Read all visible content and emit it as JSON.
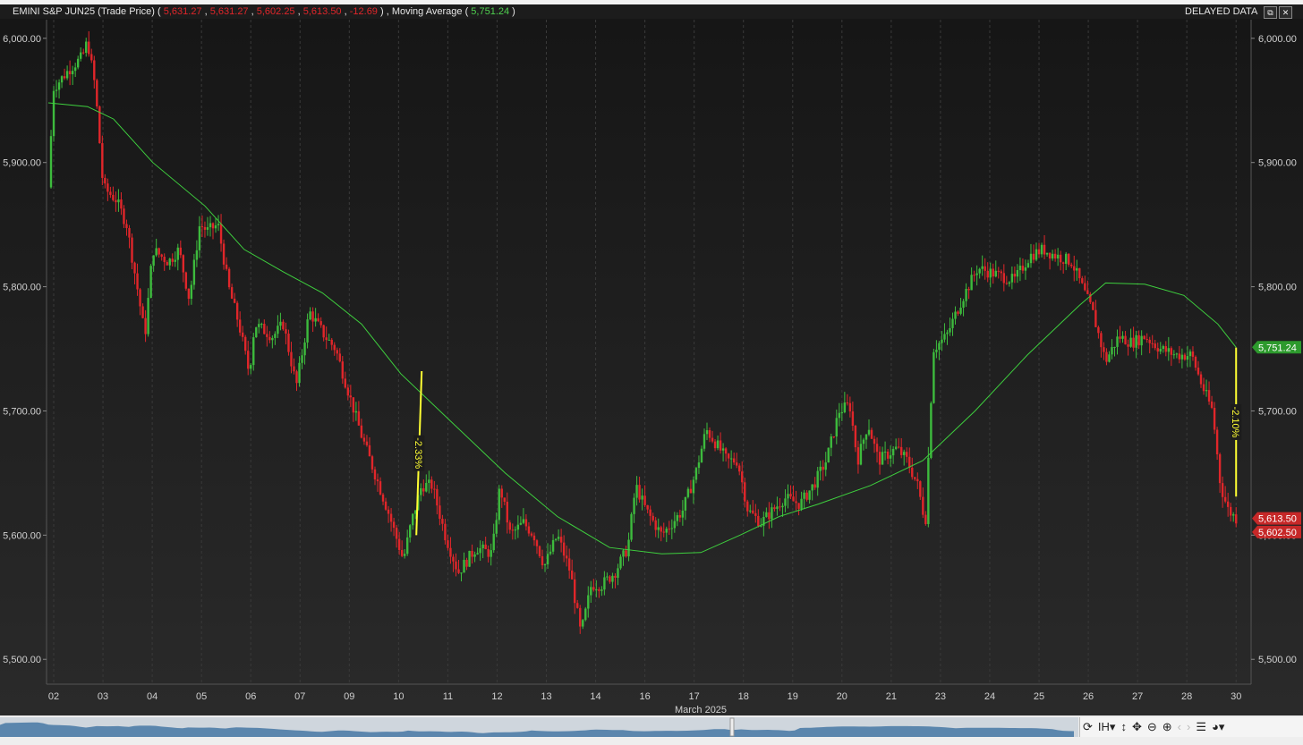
{
  "header": {
    "instrument": "EMINI S&P JUN25 (Trade Price)",
    "open": "5,631.27",
    "high": "5,631.27",
    "low": "5,602.25",
    "close": "5,613.50",
    "change": "-12.69",
    "ma_label": "Moving Average",
    "ma_value": "5,751.24",
    "delayed": "DELAYED DATA"
  },
  "colors": {
    "background": "#1c1c1c",
    "up": "#3dbb3d",
    "down": "#e0262a",
    "ma_line": "#3ecf3e",
    "annotation": "#ffff33",
    "grid": "#3a3a3a"
  },
  "toolbar": {
    "icons": [
      "refresh-icon",
      "bar-type-icon",
      "vertical-resize-icon",
      "pan-icon",
      "zoom-out-icon",
      "zoom-in-icon",
      "chevron-left-icon",
      "chevron-right-icon",
      "menu-icon",
      "palette-icon"
    ]
  },
  "chart_data": {
    "type": "candlestick",
    "title": "EMINI S&P JUN25 (Trade Price)",
    "x_title": "March 2025",
    "x_ticks": [
      "02",
      "03",
      "04",
      "05",
      "06",
      "07",
      "09",
      "10",
      "11",
      "12",
      "13",
      "14",
      "16",
      "17",
      "18",
      "19",
      "20",
      "21",
      "23",
      "24",
      "25",
      "26",
      "27",
      "28",
      "30"
    ],
    "y_ticks": [
      "6,000.00",
      "5,900.00",
      "5,800.00",
      "5,700.00",
      "5,600.00",
      "5,500.00"
    ],
    "ylim": [
      5480,
      6015
    ],
    "price_path": [
      [
        0,
        5880
      ],
      [
        0.2,
        5960
      ],
      [
        0.8,
        5975
      ],
      [
        1.3,
        5985
      ],
      [
        1.5,
        5998
      ],
      [
        1.8,
        5960
      ],
      [
        2.1,
        5880
      ],
      [
        2.6,
        5870
      ],
      [
        3.0,
        5850
      ],
      [
        3.4,
        5800
      ],
      [
        3.7,
        5760
      ],
      [
        4.0,
        5830
      ],
      [
        4.6,
        5820
      ],
      [
        5.0,
        5830
      ],
      [
        5.4,
        5790
      ],
      [
        5.8,
        5850
      ],
      [
        6.1,
        5845
      ],
      [
        6.5,
        5850
      ],
      [
        6.9,
        5800
      ],
      [
        7.3,
        5770
      ],
      [
        7.7,
        5730
      ],
      [
        7.9,
        5770
      ],
      [
        8.6,
        5760
      ],
      [
        9.0,
        5770
      ],
      [
        9.5,
        5720
      ],
      [
        10.0,
        5780
      ],
      [
        10.6,
        5760
      ],
      [
        11.0,
        5750
      ],
      [
        12.0,
        5680
      ],
      [
        13.0,
        5620
      ],
      [
        13.6,
        5580
      ],
      [
        13.9,
        5610
      ],
      [
        14.3,
        5640
      ],
      [
        14.7,
        5640
      ],
      [
        15.2,
        5600
      ],
      [
        15.7,
        5570
      ],
      [
        16.4,
        5590
      ],
      [
        17.0,
        5585
      ],
      [
        17.3,
        5640
      ],
      [
        17.7,
        5600
      ],
      [
        18.2,
        5610
      ],
      [
        18.6,
        5600
      ],
      [
        19.0,
        5575
      ],
      [
        19.5,
        5600
      ],
      [
        20.0,
        5570
      ],
      [
        20.4,
        5520
      ],
      [
        20.8,
        5560
      ],
      [
        21.2,
        5560
      ],
      [
        21.7,
        5570
      ],
      [
        22.2,
        5590
      ],
      [
        22.5,
        5640
      ],
      [
        22.9,
        5620
      ],
      [
        23.5,
        5600
      ],
      [
        24.3,
        5620
      ],
      [
        24.8,
        5650
      ],
      [
        25.2,
        5685
      ],
      [
        25.7,
        5670
      ],
      [
        26.0,
        5660
      ],
      [
        26.4,
        5660
      ],
      [
        26.8,
        5620
      ],
      [
        27.3,
        5610
      ],
      [
        28.2,
        5630
      ],
      [
        28.8,
        5625
      ],
      [
        29.3,
        5640
      ],
      [
        29.8,
        5660
      ],
      [
        30.3,
        5700
      ],
      [
        30.7,
        5705
      ],
      [
        31.0,
        5660
      ],
      [
        31.4,
        5690
      ],
      [
        31.8,
        5660
      ],
      [
        32.5,
        5670
      ],
      [
        32.9,
        5660
      ],
      [
        33.3,
        5640
      ],
      [
        33.6,
        5610
      ],
      [
        33.9,
        5750
      ],
      [
        34.4,
        5760
      ],
      [
        35.0,
        5790
      ],
      [
        35.6,
        5815
      ],
      [
        36.3,
        5810
      ],
      [
        37.0,
        5805
      ],
      [
        37.6,
        5825
      ],
      [
        38.1,
        5830
      ],
      [
        38.6,
        5825
      ],
      [
        39.2,
        5820
      ],
      [
        39.6,
        5800
      ],
      [
        40.0,
        5780
      ],
      [
        40.5,
        5740
      ],
      [
        41.0,
        5760
      ],
      [
        41.5,
        5755
      ],
      [
        42.0,
        5760
      ],
      [
        42.6,
        5750
      ],
      [
        43.2,
        5745
      ],
      [
        43.8,
        5745
      ],
      [
        44.2,
        5720
      ],
      [
        44.6,
        5700
      ],
      [
        44.9,
        5640
      ],
      [
        45.2,
        5620
      ],
      [
        45.5,
        5613.5
      ]
    ],
    "series": [
      {
        "name": "Moving Average",
        "type": "line",
        "points": [
          [
            0,
            5948
          ],
          [
            1.5,
            5945
          ],
          [
            2.5,
            5935
          ],
          [
            4.0,
            5900
          ],
          [
            6.0,
            5865
          ],
          [
            7.5,
            5830
          ],
          [
            9.0,
            5812
          ],
          [
            10.5,
            5795
          ],
          [
            12.0,
            5770
          ],
          [
            13.5,
            5730
          ],
          [
            15.5,
            5690
          ],
          [
            17.5,
            5650
          ],
          [
            19.5,
            5615
          ],
          [
            21.5,
            5590
          ],
          [
            23.5,
            5585
          ],
          [
            25.0,
            5586
          ],
          [
            26.5,
            5600
          ],
          [
            28.0,
            5615
          ],
          [
            29.5,
            5625
          ],
          [
            31.5,
            5640
          ],
          [
            33.5,
            5660
          ],
          [
            35.5,
            5700
          ],
          [
            37.5,
            5745
          ],
          [
            39.5,
            5785
          ],
          [
            40.5,
            5803
          ],
          [
            42.0,
            5802
          ],
          [
            43.5,
            5793
          ],
          [
            44.8,
            5770
          ],
          [
            45.5,
            5751.24
          ]
        ]
      }
    ],
    "price_labels": [
      {
        "value": 5751.24,
        "text": "5,751.24",
        "color": "#2d9a2d"
      },
      {
        "value": 5613.5,
        "text": "5,613.50",
        "color": "#c62828"
      },
      {
        "value": 5602.5,
        "text": "5,602.50",
        "color": "#c62828"
      }
    ],
    "annotations": [
      {
        "text": "-2.33%",
        "x": 14.2,
        "y1": 5600,
        "y2": 5732
      },
      {
        "text": "-2.10%",
        "x": 45.5,
        "y1": 5631,
        "y2": 5751
      }
    ]
  }
}
